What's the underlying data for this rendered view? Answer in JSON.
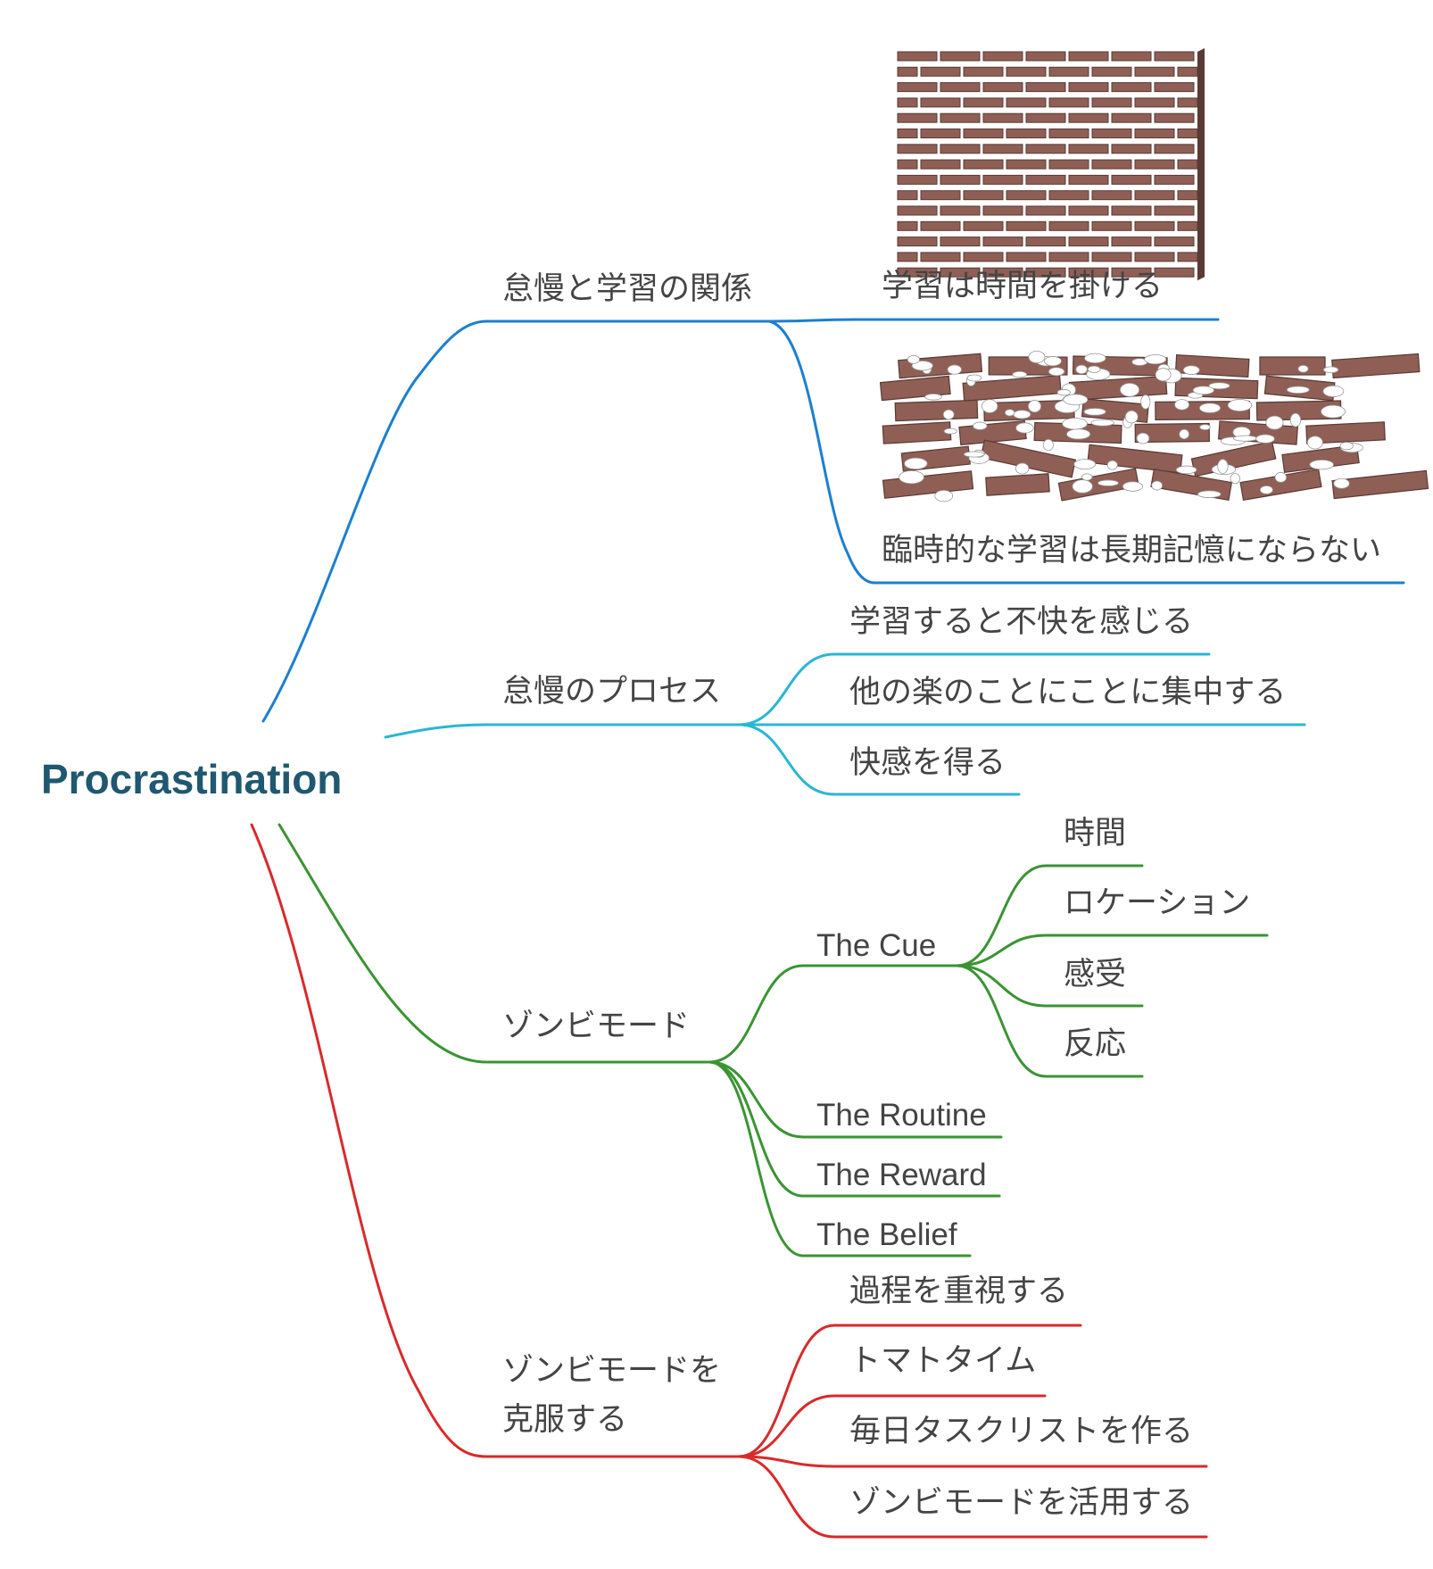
{
  "root": "Procrastination",
  "colors": {
    "root": "#1f5870",
    "text": "#444444",
    "branch_blue": "#1c7fd0",
    "branch_cyan": "#2ab6d4",
    "branch_green": "#3a9433",
    "branch_red": "#d82a2a",
    "brick": "#8f5f55",
    "brick_dark": "#5a3a34",
    "mortar": "#ffffff"
  },
  "branches": [
    {
      "label": "怠慢と学習の関係",
      "children": [
        {
          "label": "学習は時間を掛ける",
          "image": "neat-brick-wall"
        },
        {
          "label": "臨時的な学習は長期記憶にならない",
          "image": "messy-brick-wall"
        }
      ]
    },
    {
      "label": "怠慢のプロセス",
      "children": [
        {
          "label": "学習すると不快を感じる"
        },
        {
          "label": "他の楽のことにことに集中する"
        },
        {
          "label": "快感を得る"
        }
      ]
    },
    {
      "label": "ゾンビモード",
      "children": [
        {
          "label": "The Cue",
          "children": [
            "時間",
            "ロケーション",
            "感受",
            "反応"
          ]
        },
        {
          "label": "The Routine"
        },
        {
          "label": "The Reward"
        },
        {
          "label": "The Belief"
        }
      ]
    },
    {
      "label_lines": [
        "ゾンビモードを",
        "克服する"
      ],
      "children": [
        {
          "label": "過程を重視する"
        },
        {
          "label": "トマトタイム"
        },
        {
          "label": "毎日タスクリストを作る"
        },
        {
          "label": "ゾンビモードを活用する"
        }
      ]
    }
  ]
}
